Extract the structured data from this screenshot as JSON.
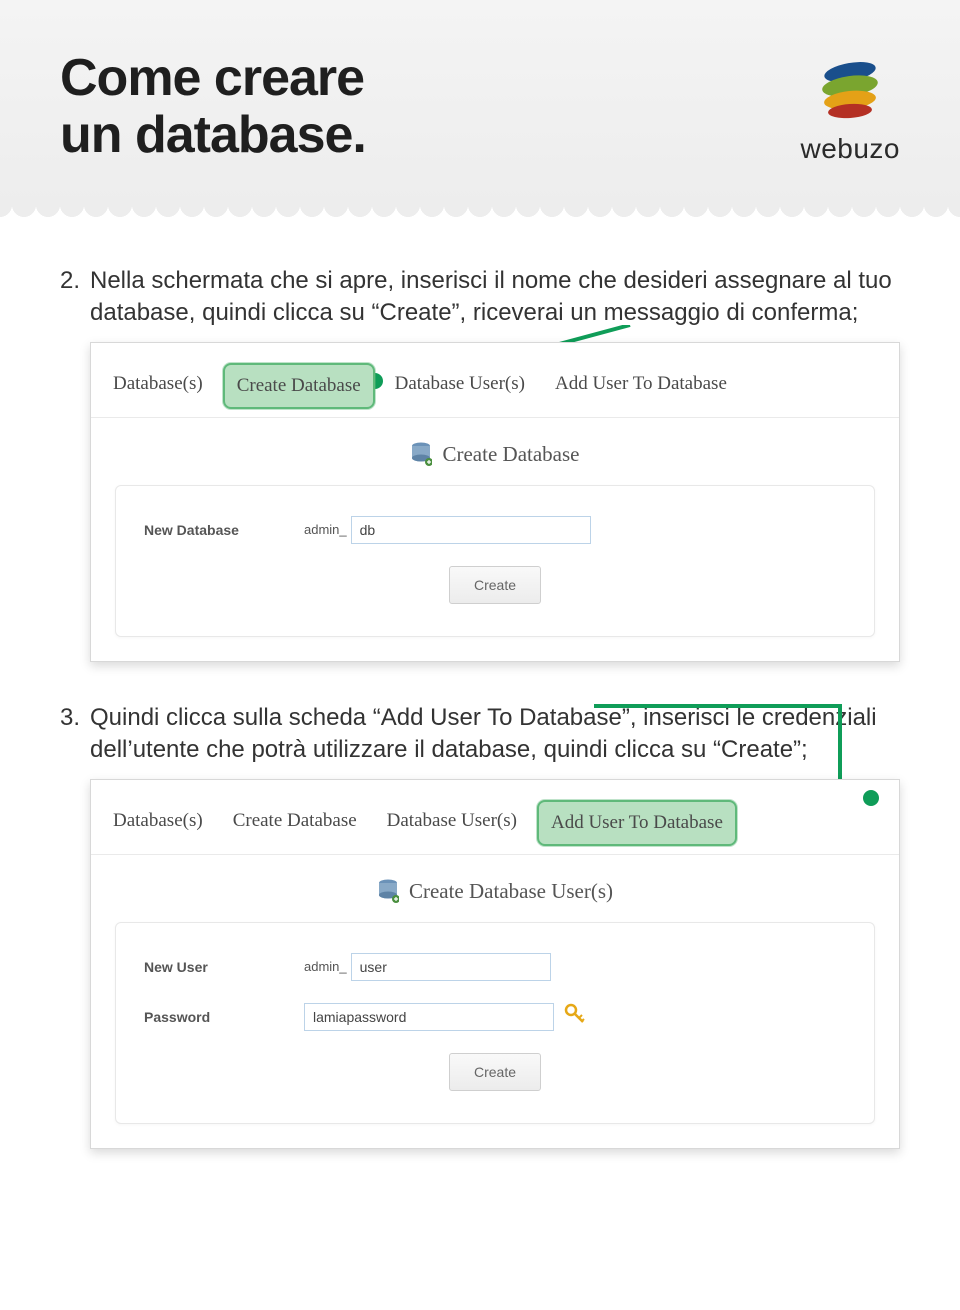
{
  "header": {
    "title_line1": "Come creare",
    "title_line2": "un database.",
    "logo_text": "webuzo"
  },
  "step2": {
    "number": "2.",
    "text": "Nella schermata che si apre, inserisci il nome che desideri assegnare al tuo database, quindi clicca su “Create”, riceverai un messaggio di conferma;",
    "tabs": {
      "databases": "Database(s)",
      "create_db": "Create Database",
      "db_users": "Database User(s)",
      "add_user": "Add User To Database"
    },
    "section_title": "Create Database",
    "form": {
      "label": "New Database",
      "prefix": "admin_",
      "value": "db",
      "button": "Create"
    }
  },
  "step3": {
    "number": "3.",
    "text": "Quindi clicca sulla scheda “Add User To Database”, inserisci le credenziali dell’utente che potrà utilizzare il database, quindi clicca su “Create”;",
    "tabs": {
      "databases": "Database(s)",
      "create_db": "Create Database",
      "db_users": "Database User(s)",
      "add_user": "Add User To Database"
    },
    "section_title": "Create Database User(s)",
    "form": {
      "user_label": "New User",
      "user_prefix": "admin_",
      "user_value": "user",
      "pass_label": "Password",
      "pass_value": "lamiapassword",
      "button": "Create"
    }
  }
}
